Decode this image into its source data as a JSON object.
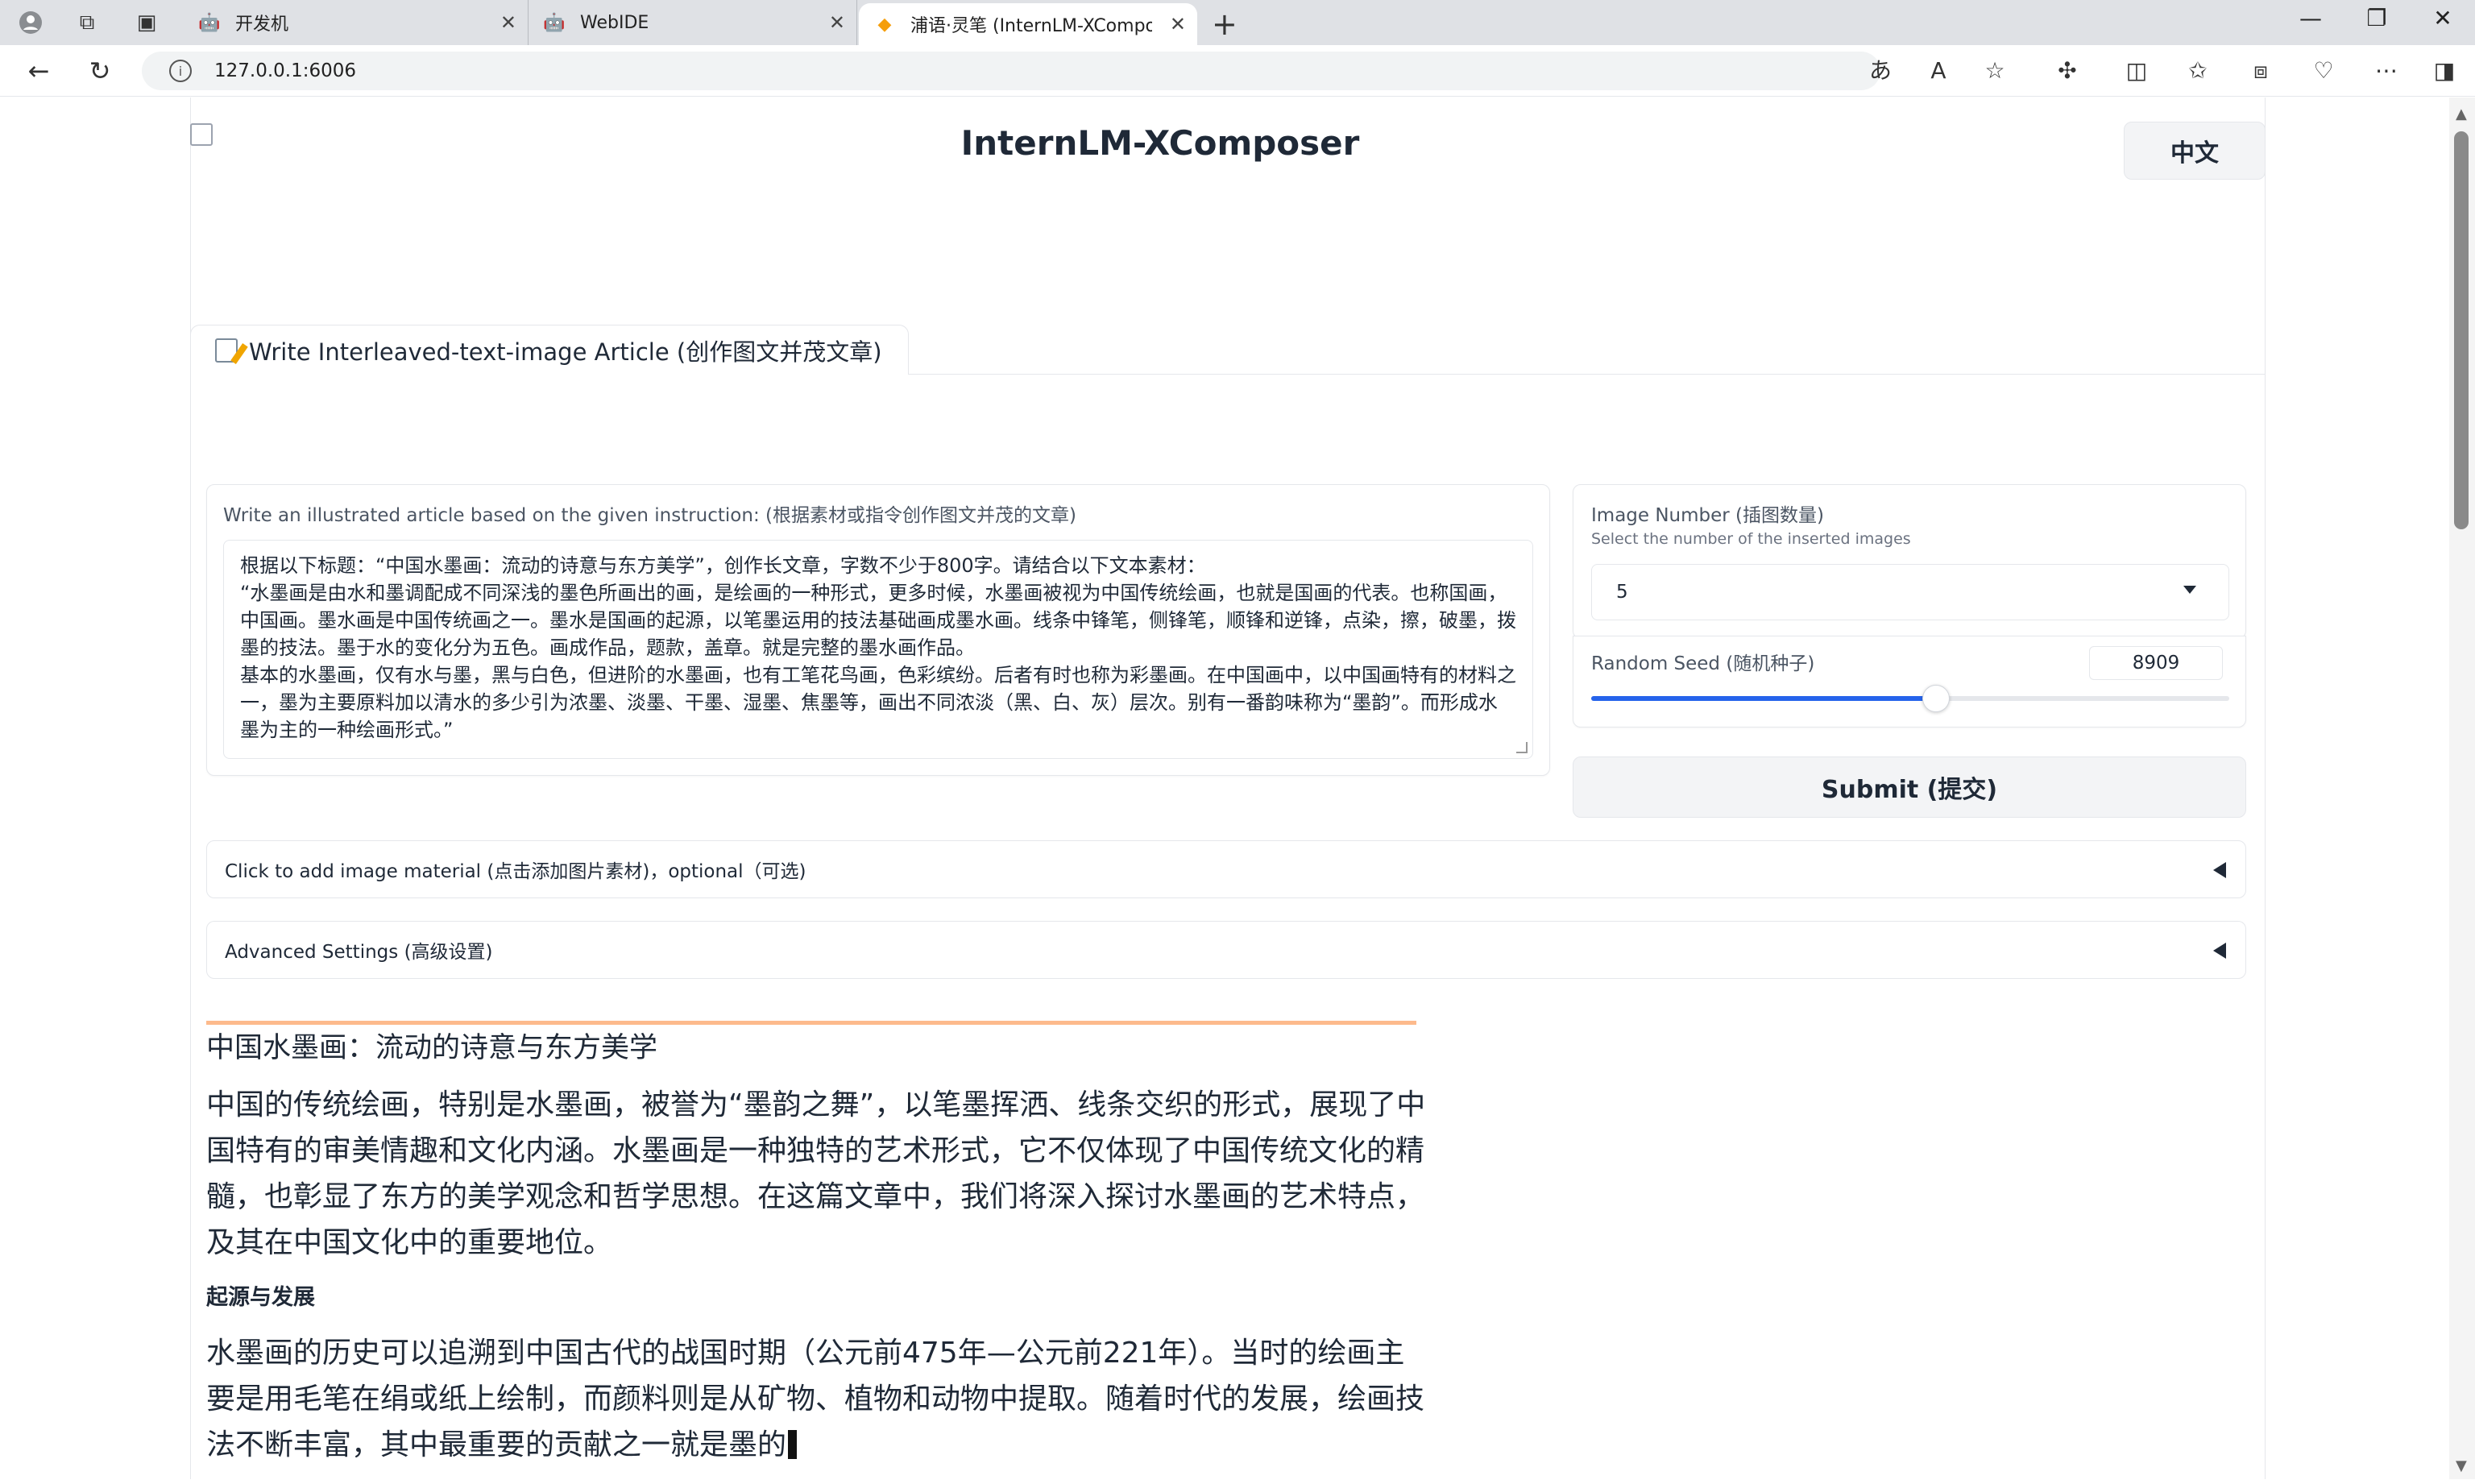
{
  "browser": {
    "tabs": [
      {
        "title": "开发机",
        "active": false
      },
      {
        "title": "WebIDE",
        "active": false
      },
      {
        "title": "浦语·灵笔 (InternLM-XComposer)",
        "active": true
      }
    ],
    "url": "127.0.0.1:6006"
  },
  "app": {
    "title": "InternLM-XComposer",
    "lang_button": "中文",
    "tab_label": "Write Interleaved-text-image Article (创作图文并茂文章)"
  },
  "instruction": {
    "label": "Write an illustrated article based on the given instruction: (根据素材或指令创作图文并茂的文章)",
    "lines": [
      "根据以下标题：“中国水墨画：流动的诗意与东方美学”，创作长文章，字数不少于800字。请结合以下文本素材：",
      "“水墨画是由水和墨调配成不同深浅的墨色所画出的画，是绘画的一种形式，更多时候，水墨画被视为中国传统绘画，也就是国画的代表。也称国画，中国画。墨水画是中国传统画之一。墨水是国画的起源，以笔墨运用的技法基础画成墨水画。线条中锋笔，侧锋笔，顺锋和逆锋，点染，擦，破墨，拨墨的技法。墨于水的变化分为五色。画成作品，题款，盖章。就是完整的墨水画作品。",
      "基本的水墨画，仅有水与墨，黑与白色，但进阶的水墨画，也有工笔花鸟画，色彩缤纷。后者有时也称为彩墨画。在中国画中，以中国画特有的材料之一，墨为主要原料加以清水的多少引为浓墨、淡墨、干墨、湿墨、焦墨等，画出不同浓淡（黑、白、灰）层次。别有一番韵味称为“墨韵”。而形成水墨为主的一种绘画形式。”"
    ]
  },
  "image_number": {
    "label": "Image Number (插图数量)",
    "sublabel": "Select the number of the inserted images",
    "value": "5"
  },
  "random_seed": {
    "label": "Random Seed (随机种子)",
    "value": "8909",
    "slider_fraction": 0.54
  },
  "submit_label": "Submit (提交)",
  "accordions": {
    "image_material": "Click to add image material (点击添加图片素材)，optional（可选)",
    "advanced": "Advanced Settings (高级设置)"
  },
  "article": {
    "title": "中国水墨画：流动的诗意与东方美学",
    "intro": "中国的传统绘画，特别是水墨画，被誉为“墨韵之舞”，以笔墨挥洒、线条交织的形式，展现了中国特有的审美情趣和文化内涵。水墨画是一种独特的艺术形式，它不仅体现了中国传统文化的精髓，也彰显了东方的美学观念和哲学思想。在这篇文章中，我们将深入探讨水墨画的艺术特点，及其在中国文化中的重要地位。",
    "section_title": "起源与发展",
    "section_text": "水墨画的历史可以追溯到中国古代的战国时期（公元前475年—公元前221年）。当时的绘画主要是用毛笔在绢或纸上绘制，而颜料则是从矿物、植物和动物中提取。随着时代的发展，绘画技法不断丰富，其中最重要的贡献之一就是墨的"
  }
}
